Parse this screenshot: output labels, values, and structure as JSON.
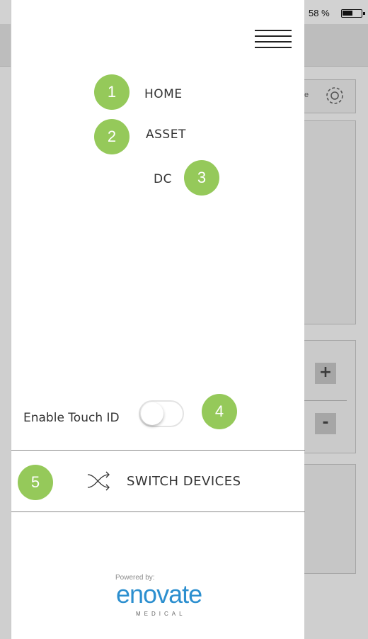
{
  "status_bar": {
    "battery_percent": "58 %"
  },
  "background": {
    "settings_partial_text": "e",
    "plus_label": "+",
    "minus_label": "-"
  },
  "drawer": {
    "menu": [
      {
        "label": "HOME",
        "badge": "1"
      },
      {
        "label": "ASSET",
        "badge": "2"
      },
      {
        "label": "DC",
        "badge": "3"
      }
    ],
    "touch_id": {
      "label": "Enable Touch ID",
      "enabled": false,
      "badge": "4"
    },
    "switch_devices": {
      "label": "SWITCH DEVICES",
      "badge": "5"
    },
    "footer": {
      "powered_by": "Powered by:",
      "brand": "enovate",
      "brand_sub": "MEDICAL"
    }
  },
  "colors": {
    "badge": "#95c95a",
    "brand": "#2c8fcf",
    "overlay": "#cfcfcf"
  },
  "icons": [
    "hamburger-menu-icon",
    "shuffle-icon",
    "gear-icon",
    "battery-icon"
  ]
}
